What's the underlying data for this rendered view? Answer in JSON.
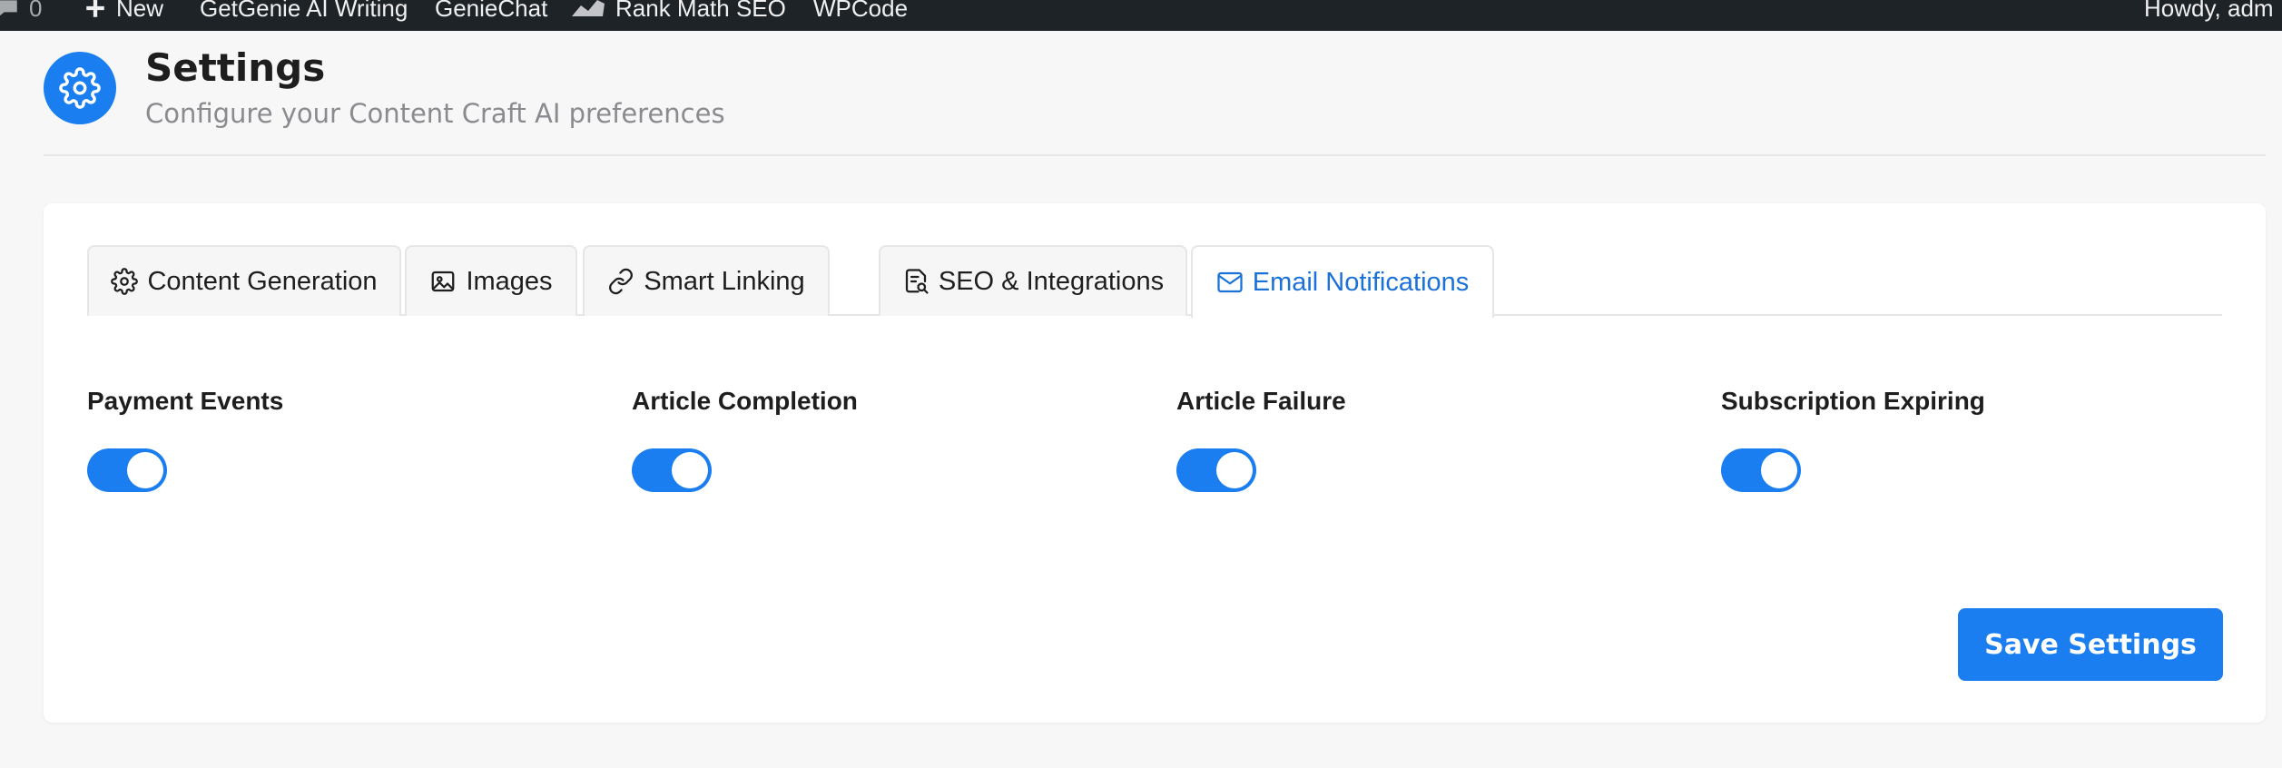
{
  "adminbar": {
    "comment_count": "0",
    "new_label": "New",
    "items": [
      "GetGenie AI Writing",
      "GenieChat",
      "Rank Math SEO",
      "WPCode"
    ],
    "howdy": "Howdy, adm"
  },
  "header": {
    "title": "Settings",
    "subtitle": "Configure your Content Craft AI preferences"
  },
  "tabs": [
    {
      "label": "Content Generation",
      "icon": "gear-icon",
      "active": false
    },
    {
      "label": "Images",
      "icon": "image-icon",
      "active": false
    },
    {
      "label": "Smart Linking",
      "icon": "link-icon",
      "active": false
    },
    {
      "label": "SEO & Integrations",
      "icon": "document-search-icon",
      "active": false
    },
    {
      "label": "Email Notifications",
      "icon": "envelope-icon",
      "active": true
    }
  ],
  "notifications": [
    {
      "label": "Payment Events",
      "enabled": true
    },
    {
      "label": "Article Completion",
      "enabled": true
    },
    {
      "label": "Article Failure",
      "enabled": true
    },
    {
      "label": "Subscription Expiring",
      "enabled": true
    }
  ],
  "save_label": "Save Settings",
  "colors": {
    "accent": "#1a7df0",
    "admin_bar": "#1d2327",
    "active_tab_text": "#1a72d8"
  }
}
